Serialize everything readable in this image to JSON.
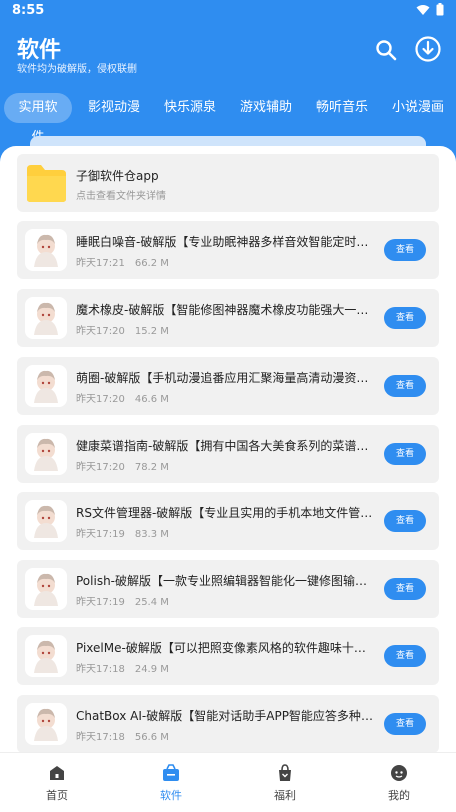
{
  "status": {
    "time": "8:55"
  },
  "header": {
    "title": "软件",
    "subtitle": "软件均为破解版，侵权联删"
  },
  "tabs": [
    {
      "label": "实用软件",
      "active": true
    },
    {
      "label": "影视动漫",
      "active": false
    },
    {
      "label": "快乐源泉",
      "active": false
    },
    {
      "label": "游戏辅助",
      "active": false
    },
    {
      "label": "畅听音乐",
      "active": false
    },
    {
      "label": "小说漫画",
      "active": false
    }
  ],
  "folder": {
    "title": "子御软件仓app",
    "subtitle": "点击查看文件夹详情"
  },
  "view_label": "查看",
  "items": [
    {
      "name": "睡眠白噪音-破解版【专业助眠神器多样音效智能定时轻松入睡】",
      "time": "昨天17:21",
      "size": "66.2 M"
    },
    {
      "name": "魔术橡皮-破解版【智能修图神器魔术橡皮功能强大一键去除】",
      "time": "昨天17:20",
      "size": "15.2 M"
    },
    {
      "name": "萌圈-破解版【手机动漫追番应用汇聚海量高清动漫资源】",
      "time": "昨天17:20",
      "size": "46.6 M"
    },
    {
      "name": "健康菜谱指南-破解版【拥有中国各大美食系列的菜谱和做法】",
      "time": "昨天17:20",
      "size": "78.2 M"
    },
    {
      "name": "RS文件管理器-破解版【专业且实用的手机本地文件管理工具】",
      "time": "昨天17:19",
      "size": "83.3 M"
    },
    {
      "name": "Polish-破解版【一款专业照编辑器智能化一键修图输出高清】",
      "time": "昨天17:19",
      "size": "25.4 M"
    },
    {
      "name": "PixelMe-破解版【可以把照变像素风格的软件趣味十足AI转换】",
      "time": "昨天17:18",
      "size": "24.9 M"
    },
    {
      "name": "ChatBox AI-破解版【智能对话助手APP智能应答多种主题】",
      "time": "昨天17:18",
      "size": "56.6 M"
    }
  ],
  "nav": [
    {
      "label": "首页",
      "icon": "home-icon",
      "active": false
    },
    {
      "label": "软件",
      "icon": "software-icon",
      "active": true
    },
    {
      "label": "福利",
      "icon": "gift-icon",
      "active": false
    },
    {
      "label": "我的",
      "icon": "profile-icon",
      "active": false
    }
  ],
  "colors": {
    "primary": "#2f8df0",
    "card": "#f1f1f1",
    "folder": "#ffcf3d"
  }
}
